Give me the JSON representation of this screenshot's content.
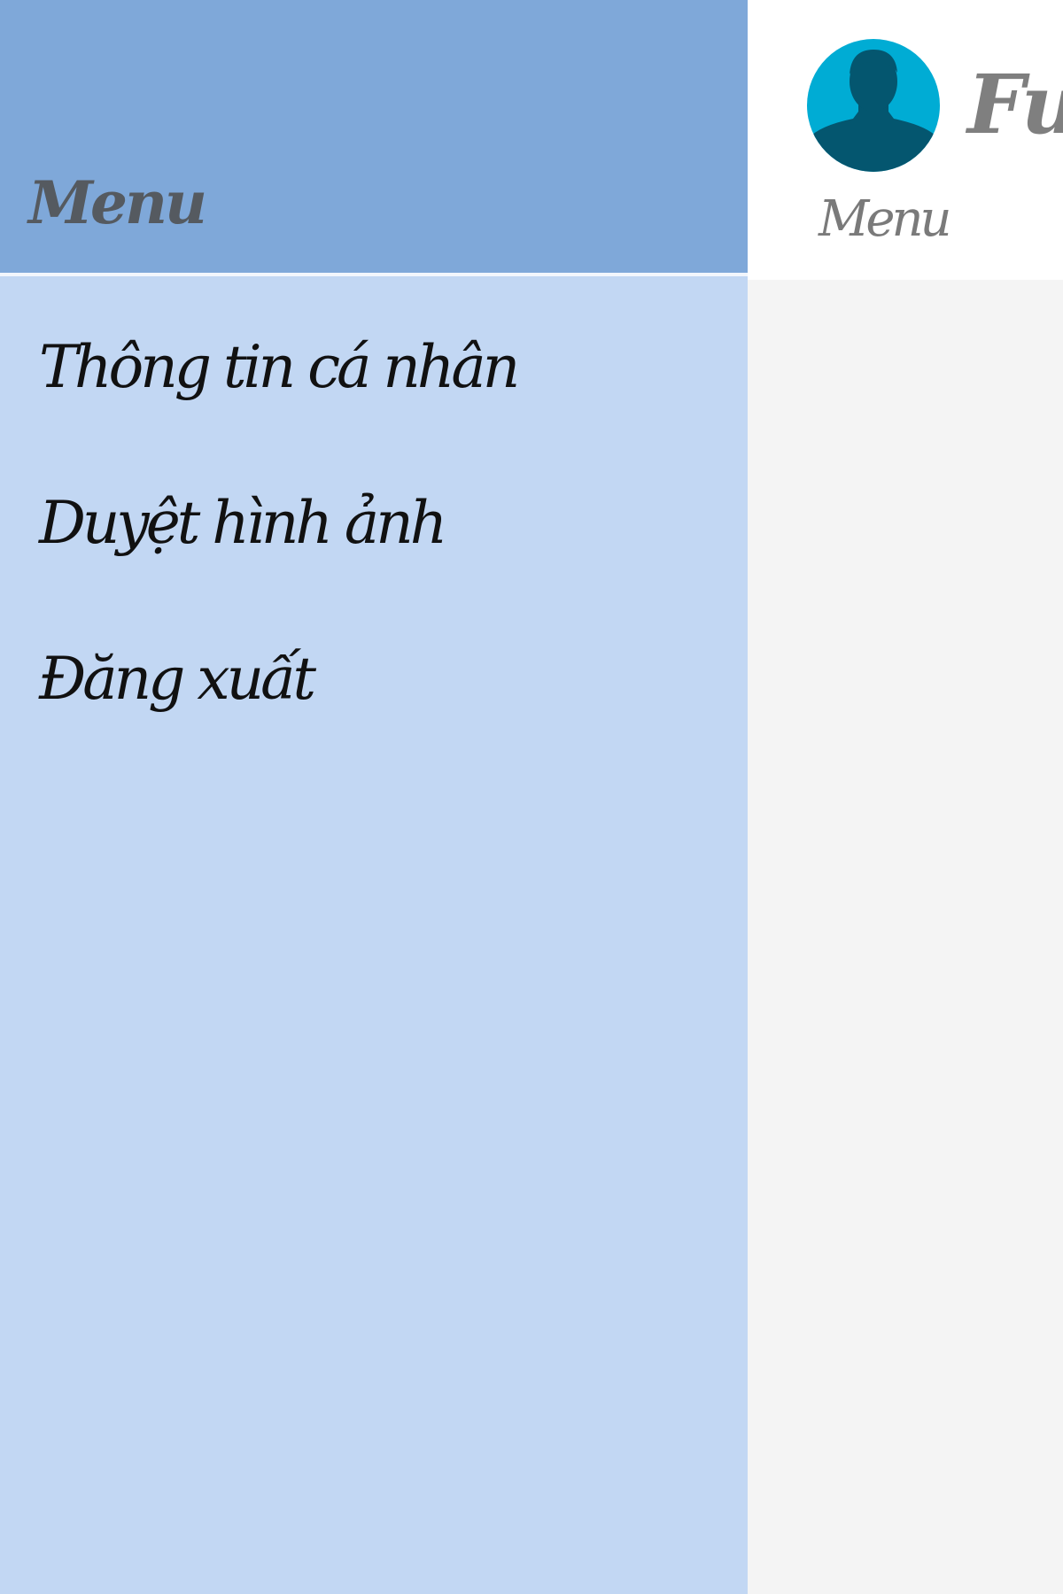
{
  "drawer": {
    "title": "Menu",
    "items": [
      {
        "label": "Thông tin cá nhân",
        "icon": ""
      },
      {
        "label": "Duyệt hình ảnh",
        "icon": ""
      },
      {
        "label": "Đăng xuất",
        "icon": ""
      }
    ]
  },
  "header": {
    "avatar_icon": "user-silhouette-icon",
    "user_name": "Fu",
    "menu_label": "Menu"
  },
  "colors": {
    "drawer_background": "#c2d7f3",
    "drawer_header": "#7fa8d9",
    "avatar_background": "#00acd4",
    "avatar_figure": "#04566f",
    "content_background": "#f4f4f4"
  }
}
